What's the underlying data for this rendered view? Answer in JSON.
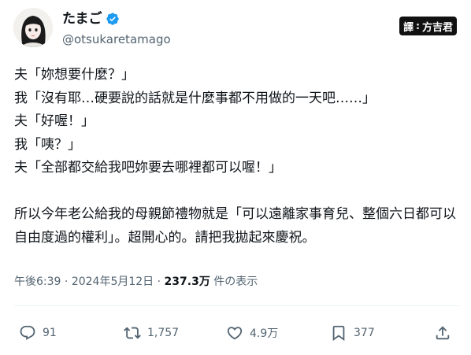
{
  "author": {
    "display_name": "たまご",
    "handle": "@otsukaretamago",
    "verified_icon": "verified-badge-icon",
    "avatar_icon": "avatar-portrait"
  },
  "badge": {
    "label_left": "譯",
    "separator": ":",
    "label_right": "方吉君"
  },
  "tweet": {
    "text": "夫「妳想要什麼？」\n我「沒有耶…硬要說的話就是什麼事都不用做的一天吧……」\n夫「好喔！」\n我「咦？」\n夫「全部都交給我吧妳要去哪裡都可以喔！」\n\n所以今年老公給我的母親節禮物就是「可以遠離家事育兒、整個六日都可以自由度過的權利」。超開心的。請把我拋起來慶祝。"
  },
  "meta": {
    "time": "午後6:39",
    "sep1": " · ",
    "date": "2024年5月12日",
    "sep2": " · ",
    "views": "237.3万",
    "views_suffix": " 件の表示"
  },
  "actions": {
    "reply": {
      "count": "91",
      "icon": "reply-icon"
    },
    "retweet": {
      "count": "1,757",
      "icon": "retweet-icon"
    },
    "like": {
      "count": "4.9万",
      "icon": "heart-icon"
    },
    "bookmark": {
      "count": "377",
      "icon": "bookmark-icon"
    },
    "share": {
      "icon": "share-icon"
    }
  },
  "colors": {
    "text": "#0f1419",
    "secondary": "#536471",
    "verified": "#1d9bf0",
    "divider": "#eff3f4"
  }
}
